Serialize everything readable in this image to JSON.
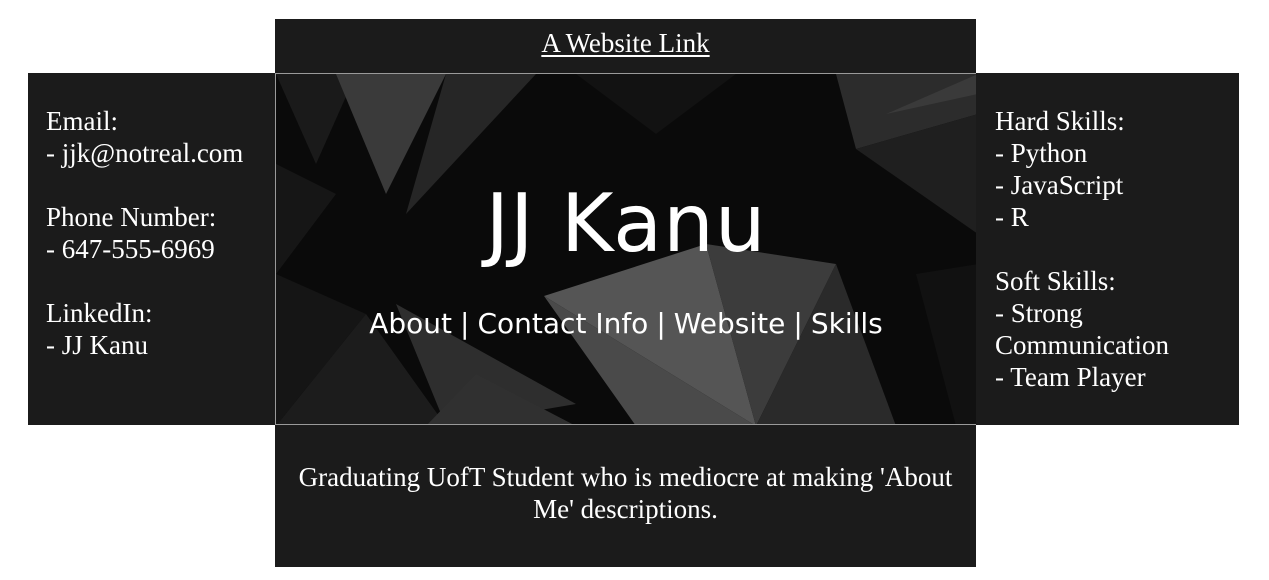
{
  "header": {
    "link_label": "A Website Link"
  },
  "contact": {
    "email_label": "Email:",
    "email_value": "- jjk@notreal.com",
    "phone_label": "Phone Number:",
    "phone_value": "- 647-555-6969",
    "linkedin_label": "LinkedIn:",
    "linkedin_value": "- JJ Kanu"
  },
  "hero": {
    "name": "JJ Kanu",
    "nav": {
      "about": "About",
      "contact": "Contact Info",
      "website": "Website",
      "skills": "Skills",
      "separator": "|"
    }
  },
  "skills": {
    "hard_label": "Hard Skills:",
    "hard_items": [
      "- Python",
      "- JavaScript",
      "- R"
    ],
    "soft_label": "Soft Skills:",
    "soft_items": [
      "- Strong Communication",
      "- Team Player"
    ]
  },
  "about": {
    "description": "Graduating UofT Student who is mediocre at making 'About Me' descriptions."
  },
  "colors": {
    "panel_bg": "#1b1b1b",
    "hero_bg": "#0b0b0b",
    "text": "#ffffff",
    "page_bg": "#ffffff"
  }
}
